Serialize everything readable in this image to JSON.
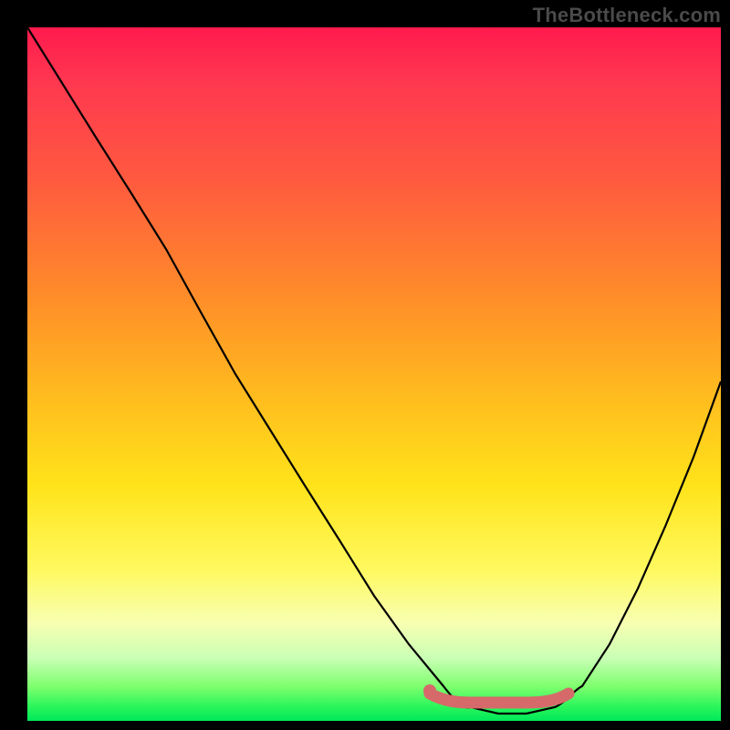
{
  "watermark": "TheBottleneck.com",
  "chart_data": {
    "type": "line",
    "title": "",
    "xlabel": "",
    "ylabel": "",
    "xlim": [
      0,
      100
    ],
    "ylim": [
      0,
      100
    ],
    "grid": false,
    "series": [
      {
        "name": "bottleneck-curve",
        "x": [
          0,
          5,
          10,
          15,
          20,
          25,
          30,
          35,
          40,
          45,
          50,
          55,
          60,
          64,
          68,
          72,
          76,
          80,
          84,
          88,
          92,
          96,
          100
        ],
        "values": [
          100,
          92,
          84,
          76,
          68,
          59,
          50,
          42,
          34,
          26,
          18,
          11,
          5,
          2,
          1,
          1,
          2,
          5,
          11,
          19,
          28,
          38,
          49
        ]
      },
      {
        "name": "highlight-band",
        "x": [
          58,
          62,
          66,
          70,
          74,
          78
        ],
        "values": [
          4,
          3,
          3,
          3,
          3,
          4
        ]
      }
    ],
    "highlight_marker": {
      "x": 58,
      "y": 4
    },
    "gradient_stops": [
      {
        "pos": 0,
        "color": "#ff1a4d"
      },
      {
        "pos": 8,
        "color": "#ff3850"
      },
      {
        "pos": 22,
        "color": "#ff5a3f"
      },
      {
        "pos": 38,
        "color": "#ff8a2a"
      },
      {
        "pos": 52,
        "color": "#ffb81f"
      },
      {
        "pos": 66,
        "color": "#ffe31a"
      },
      {
        "pos": 78,
        "color": "#fff95e"
      },
      {
        "pos": 86,
        "color": "#f7ffb2"
      },
      {
        "pos": 91,
        "color": "#c8ffb4"
      },
      {
        "pos": 95,
        "color": "#7fff6e"
      },
      {
        "pos": 98,
        "color": "#29f55a"
      },
      {
        "pos": 100,
        "color": "#00e85a"
      }
    ],
    "colors": {
      "curve": "#000000",
      "highlight": "#d66a6a",
      "background_frame": "#000000"
    }
  }
}
